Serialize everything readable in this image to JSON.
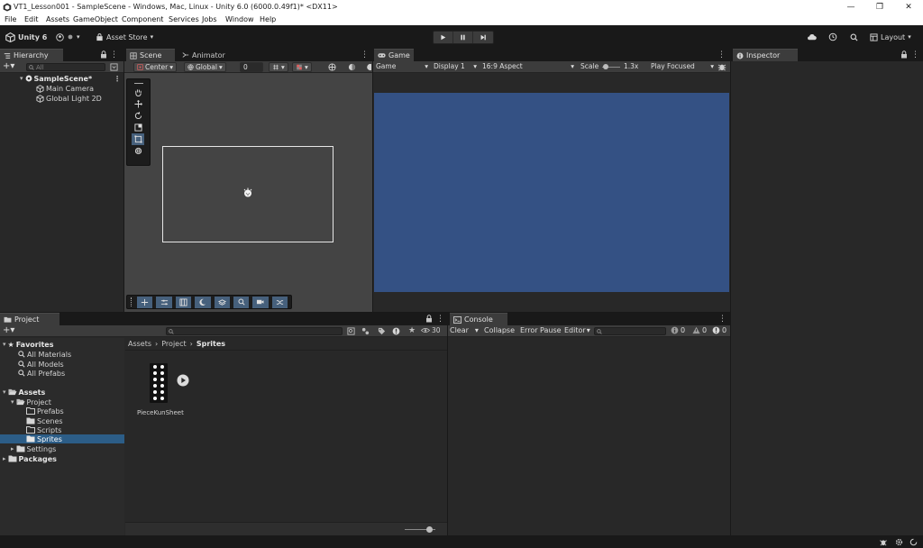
{
  "window": {
    "title": "VT1_Lesson001 - SampleScene - Windows, Mac, Linux - Unity 6.0 (6000.0.49f1)* <DX11>",
    "controls": [
      "—",
      "❐",
      "✕"
    ]
  },
  "menu": [
    "File",
    "Edit",
    "Assets",
    "GameObject",
    "Component",
    "Services",
    "Jobs",
    "Window",
    "Help"
  ],
  "toolbar": {
    "account_label": "Unity 6",
    "asset_store_label": "Asset Store",
    "layout_label": "Layout"
  },
  "hierarchy": {
    "tab_label": "Hierarchy",
    "search_placeholder": "All",
    "scene_name": "SampleScene*",
    "items": [
      "Main Camera",
      "Global Light 2D"
    ]
  },
  "scene": {
    "tab_label": "Scene",
    "animator_tab_label": "Animator",
    "pivot_label": "Center",
    "space_label": "Global",
    "snap_value": "0"
  },
  "game": {
    "tab_label": "Game",
    "mode_label": "Game",
    "display_label": "Display 1",
    "aspect_label": "16:9 Aspect",
    "scale_label": "Scale",
    "scale_value": "1.3x",
    "play_mode_label": "Play Focused",
    "background_color": "#345184"
  },
  "inspector": {
    "tab_label": "Inspector"
  },
  "project": {
    "tab_label": "Project",
    "favorites_label": "Favorites",
    "favorites": [
      "All Materials",
      "All Models",
      "All Prefabs"
    ],
    "assets_label": "Assets",
    "project_folder": "Project",
    "subfolders": [
      "Prefabs",
      "Scenes",
      "Scripts",
      "Sprites"
    ],
    "settings_folder": "Settings",
    "packages_label": "Packages",
    "breadcrumb": [
      "Assets",
      "Project",
      "Sprites"
    ],
    "hidden_count": "30",
    "asset_name": "PieceKunSheet"
  },
  "console": {
    "tab_label": "Console",
    "clear_label": "Clear",
    "collapse_label": "Collapse",
    "error_pause_label": "Error Pause",
    "editor_label": "Editor",
    "info_count": "0",
    "warn_count": "0",
    "error_count": "0"
  },
  "colors": {
    "selection": "#2c5d87",
    "panel": "#282828",
    "accent": "#46607c"
  }
}
